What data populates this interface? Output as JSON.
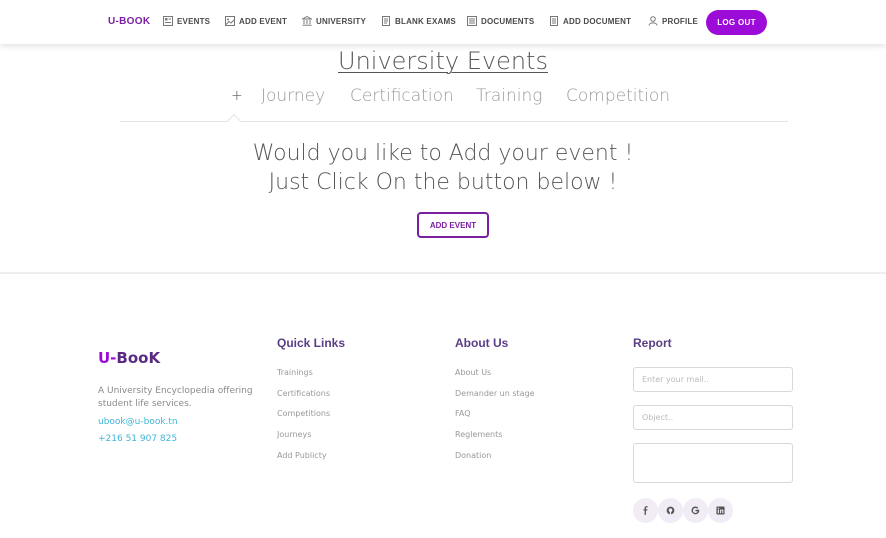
{
  "navbar": {
    "brand": "U-BOOK",
    "items": [
      {
        "label": "EVENTS",
        "icon": "events-icon"
      },
      {
        "label": "ADD EVENT",
        "icon": "image-icon"
      },
      {
        "label": "UNIVERSITY",
        "icon": "university-icon"
      },
      {
        "label": "BLANK EXAMS",
        "icon": "document-icon"
      },
      {
        "label": "DOCUMENTS",
        "icon": "documents-icon"
      },
      {
        "label": "ADD DOCUMENT",
        "icon": "file-icon"
      },
      {
        "label": "PROFILE",
        "icon": "user-icon"
      }
    ],
    "logout_label": "LOG OUT"
  },
  "main": {
    "title": "University Events",
    "tabs": [
      "+",
      "Journey",
      "Certification",
      "Training",
      "Competition"
    ],
    "headline_line1": "Would you like to Add your event !",
    "headline_line2": "Just Click On the button below !",
    "add_event_label": "ADD EVENT"
  },
  "footer": {
    "brand_prefix": "U-",
    "brand_rest": "BooK",
    "description": "A University Encyclopedia offering student life services.",
    "email": "ubook@u-book.tn",
    "phone": "+216 51 907 825",
    "quick_links": {
      "title": "Quick Links",
      "links": [
        "Trainings",
        "Certifications",
        "Competitions",
        "Journeys",
        "Add Publicty"
      ]
    },
    "about": {
      "title": "About Us",
      "links": [
        "About Us",
        "Demander un stage",
        "FAQ",
        "Reglements",
        "Donation"
      ]
    },
    "report": {
      "title": "Report",
      "email_placeholder": "Enter your mail..",
      "object_placeholder": "Object.."
    },
    "socials": [
      "facebook-icon",
      "github-icon",
      "google-icon",
      "linkedin-icon"
    ]
  },
  "colors": {
    "brand_purple": "#9c0bd8",
    "title_purple": "#5a3e85",
    "link_cyan": "#3fb5d6"
  }
}
